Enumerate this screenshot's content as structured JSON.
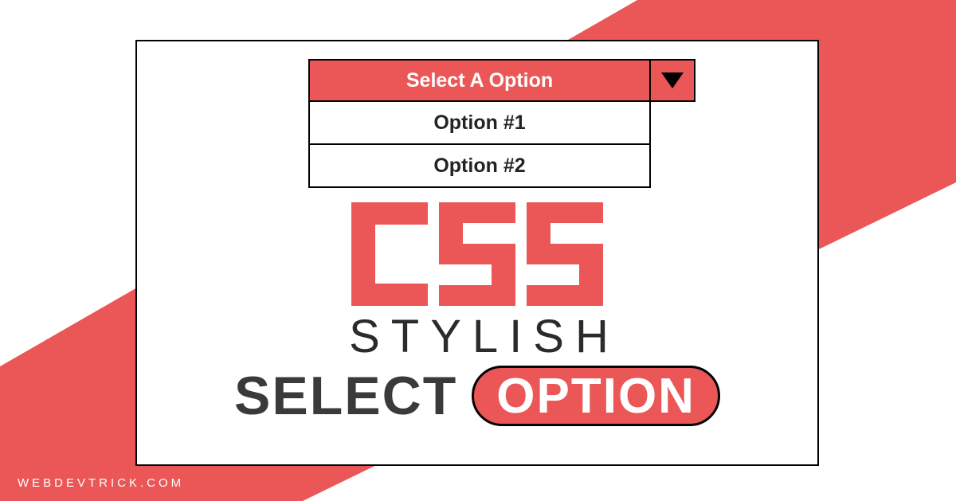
{
  "colors": {
    "accent": "#eb5757",
    "dark": "#2b2b2b"
  },
  "select": {
    "placeholder": "Select A Option",
    "options": [
      "Option #1",
      "Option #2"
    ]
  },
  "title": {
    "logo": "CSS",
    "line2": "STYLISH",
    "line3_a": "SELECT",
    "line3_b": "OPTION"
  },
  "watermark": "WEBDEVTRICK.COM"
}
